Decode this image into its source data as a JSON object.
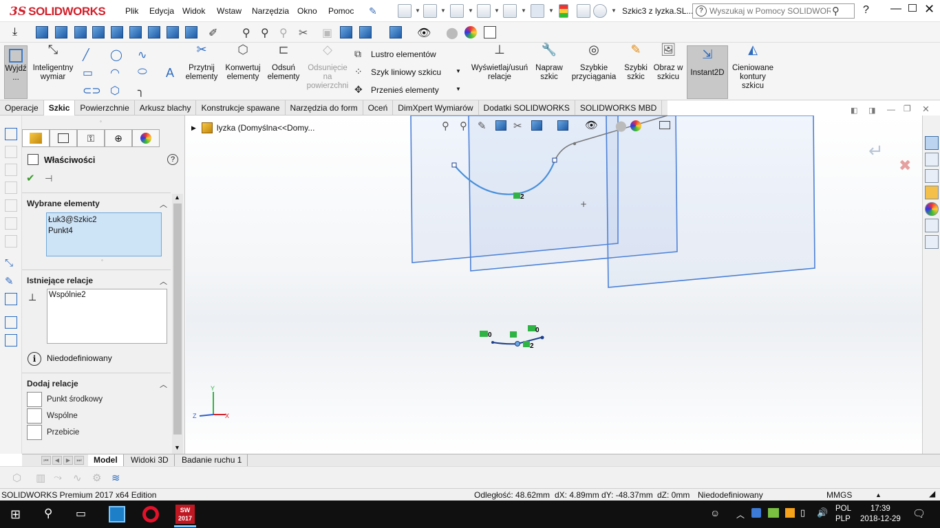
{
  "app": {
    "brand": "SOLIDWORKS",
    "document_title": "Szkic3 z lyzka.SL...",
    "help_search_placeholder": "Wyszukaj w Pomocy SOLIDWORKS"
  },
  "menu": [
    "Plik",
    "Edycja",
    "Widok",
    "Wstaw",
    "Narzędzia",
    "Okno",
    "Pomoc"
  ],
  "command_manager": {
    "exit_sketch": "Wyjdź ...",
    "smart_dimension": [
      "Inteligentny",
      "wymiar"
    ],
    "trim": [
      "Przytnij",
      "elementy"
    ],
    "convert": [
      "Konwertuj",
      "elementy"
    ],
    "offset": [
      "Odsuń",
      "elementy"
    ],
    "offset_surface": [
      "Odsunięcie",
      "na",
      "powierzchni"
    ],
    "mirror": "Lustro elementów",
    "linear_pattern": "Szyk liniowy szkicu",
    "move": "Przenieś elementy",
    "display_relations": [
      "Wyświetlaj/usuń",
      "relacje"
    ],
    "repair": [
      "Napraw",
      "szkic"
    ],
    "quick_snaps": [
      "Szybkie",
      "przyciągania"
    ],
    "rapid_sketch": [
      "Szybki",
      "szkic"
    ],
    "sketch_picture": [
      "Obraz w",
      "szkicu"
    ],
    "instant2d": "Instant2D",
    "shaded_contours": [
      "Cieniowane",
      "kontury",
      "szkicu"
    ]
  },
  "tabs": [
    {
      "label": "Operacje",
      "active": false
    },
    {
      "label": "Szkic",
      "active": true
    },
    {
      "label": "Powierzchnie",
      "active": false
    },
    {
      "label": "Arkusz blachy",
      "active": false
    },
    {
      "label": "Konstrukcje spawane",
      "active": false
    },
    {
      "label": "Narzędzia do form",
      "active": false
    },
    {
      "label": "Oceń",
      "active": false
    },
    {
      "label": "DimXpert Wymiarów",
      "active": false
    },
    {
      "label": "Dodatki SOLIDWORKS",
      "active": false
    },
    {
      "label": "SOLIDWORKS MBD",
      "active": false
    }
  ],
  "property_manager": {
    "title": "Właściwości",
    "selected_title": "Wybrane elementy",
    "selected_items": [
      "Łuk3@Szkic2",
      "Punkt4"
    ],
    "existing_title": "Istniejące relacje",
    "existing_items": [
      "Wspólnie2"
    ],
    "status": "Niedodefiniowany",
    "add_title": "Dodaj relacje",
    "add_items": [
      "Punkt środkowy",
      "Wspólne",
      "Przebicie"
    ]
  },
  "tree": {
    "node": "lyzka  (Domyślna<<Domy..."
  },
  "graphics": {
    "labels": [
      "2",
      "0",
      "0",
      "2"
    ],
    "axis_x": "X",
    "axis_y": "Y",
    "axis_z": "Z"
  },
  "model_tabs": [
    {
      "label": "Model",
      "active": true
    },
    {
      "label": "Widoki 3D",
      "active": false
    },
    {
      "label": "Badanie ruchu 1",
      "active": false
    }
  ],
  "status_bar": {
    "edition": "SOLIDWORKS Premium 2017 x64 Edition",
    "distance": "Odległość: 48.62mm",
    "dx": "dX: 4.89mm",
    "dy": "dY: -48.37mm",
    "dz": "dZ: 0mm",
    "state": "Niedodefiniowany",
    "units": "MMGS"
  },
  "taskbar": {
    "lang": "POL",
    "layout": "PLP",
    "time": "17:39",
    "date": "2018-12-29",
    "sw_badge": "2017"
  },
  "colors": {
    "brand_red": "#d0202a",
    "selection_blue": "#cde3f6",
    "sketch_blue": "#4a90d9",
    "plane_blue": "#4a7fd6",
    "relation_green": "#2fb344"
  }
}
